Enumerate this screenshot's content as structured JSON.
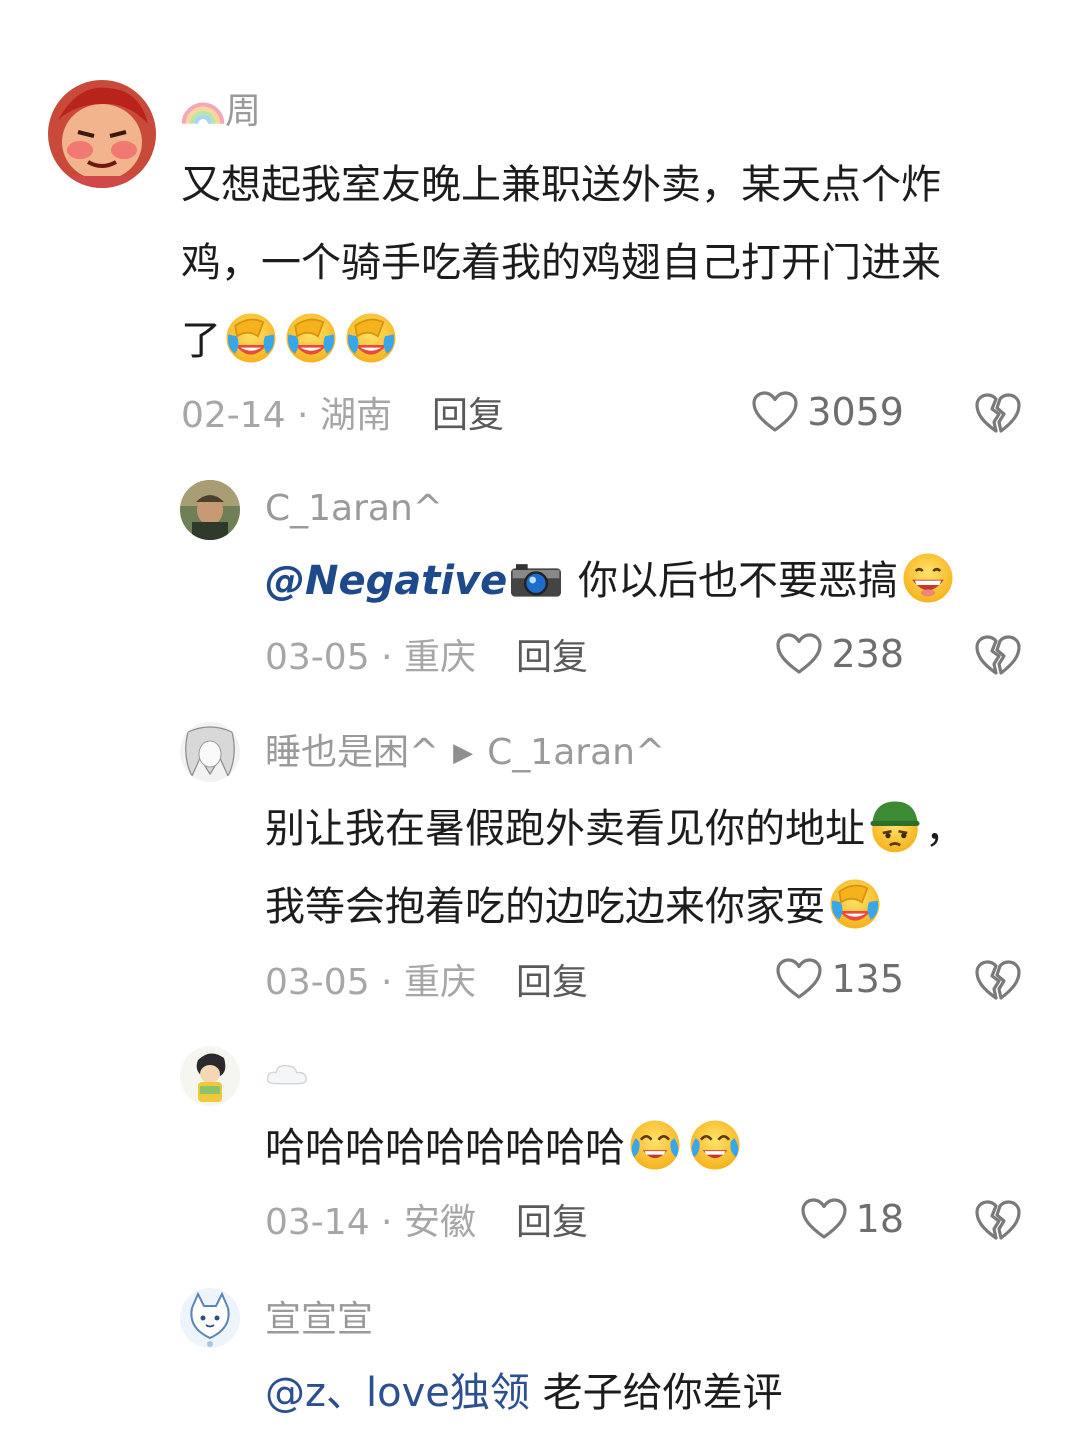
{
  "comments": [
    {
      "username": "周",
      "username_prefix_icon": "rainbow-icon",
      "text_lines": [
        "又想起我室友晚上兼职送外卖，某天点个炸",
        "鸡，一个骑手吃着我的鸡翅自己打开门进来",
        "了"
      ],
      "trailing_emojis": [
        "laugh-cry-emoji",
        "laugh-cry-emoji",
        "laugh-cry-emoji"
      ],
      "date": "02-14",
      "location": "湖南",
      "reply_label": "回复",
      "likes": "3059"
    },
    {
      "username": "C_1aran^",
      "mention": "@Negative",
      "mention_suffix_icon": "camera-emoji",
      "text": "你以后也不要恶搞",
      "trailing_emojis": [
        "grin-emoji"
      ],
      "date": "03-05",
      "location": "重庆",
      "reply_label": "回复",
      "likes": "238"
    },
    {
      "username": "睡也是困^",
      "reply_to": "C_1aran^",
      "line1": "别让我在暑假跑外卖看见你的地址",
      "line1_emoji": "soldier-emoji",
      "line1_tail": "，",
      "line2": "我等会抱着吃的边吃边来你家耍",
      "line2_emoji": "laugh-cry-emoji",
      "date": "03-05",
      "location": "重庆",
      "reply_label": "回复",
      "likes": "135"
    },
    {
      "username_icon": "cloud-emoji",
      "text": "哈哈哈哈哈哈哈哈哈",
      "trailing_emojis": [
        "tears-of-joy-emoji",
        "tears-of-joy-emoji"
      ],
      "date": "03-14",
      "location": "安徽",
      "reply_label": "回复",
      "likes": "18"
    },
    {
      "username": "宣宣宣",
      "mention": "@z、love独领",
      "text": "老子给你差评"
    }
  ],
  "meta_separator": " · ",
  "colors": {
    "accent_link": "#2c4f92",
    "meta_gray": "#a6a6a6",
    "text": "#1c1c1c"
  }
}
